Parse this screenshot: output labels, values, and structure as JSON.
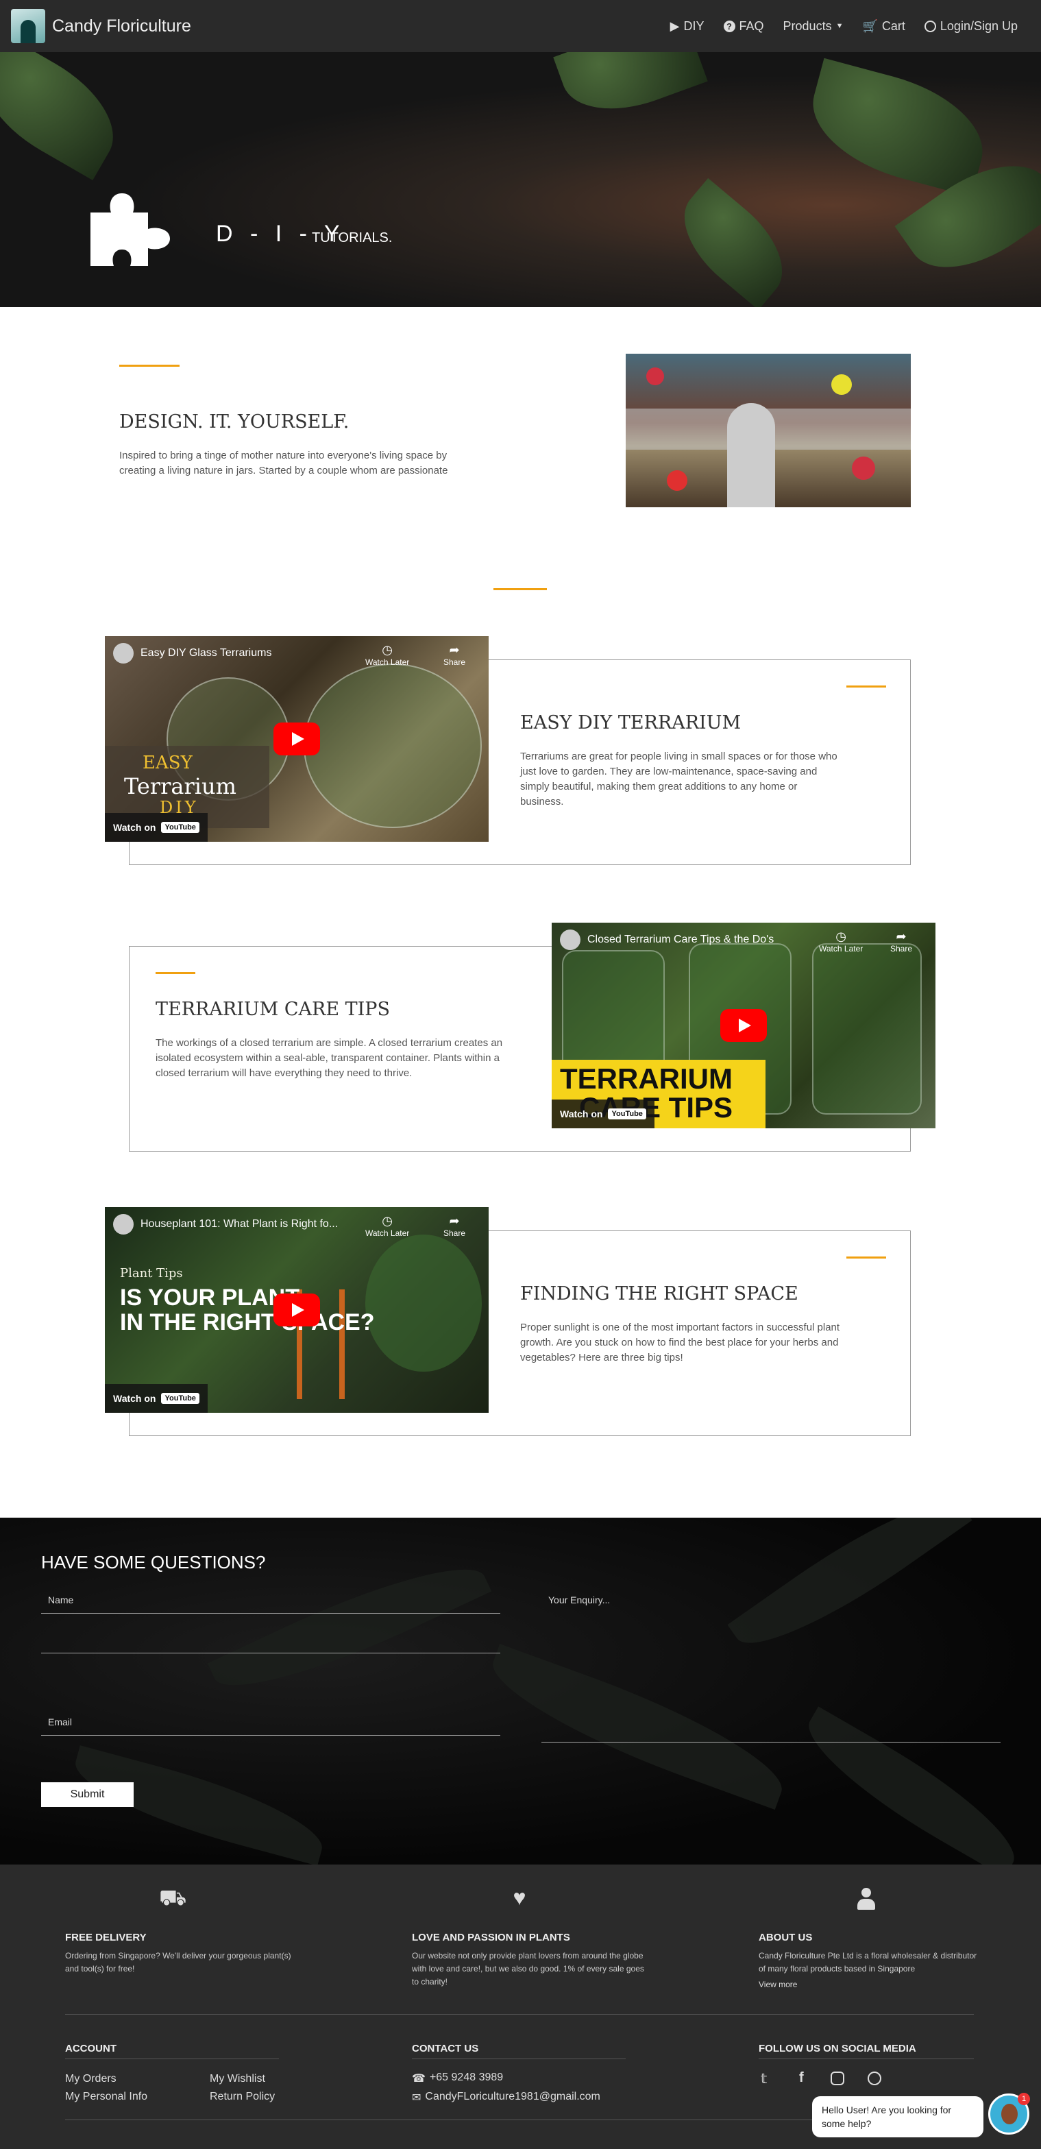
{
  "nav": {
    "brand": "Candy Floriculture",
    "diy": "DIY",
    "faq": "FAQ",
    "products": "Products",
    "cart": "Cart",
    "login": "Login/Sign Up"
  },
  "hero": {
    "title": "D - I - Y",
    "subtitle": "TUTORIALS."
  },
  "intro": {
    "heading": "DESIGN. IT. YOURSELF.",
    "text": "Inspired to bring a tinge of mother nature into everyone's living space by creating a living nature in jars. Started by a couple whom are passionate"
  },
  "tutorials": [
    {
      "video_title": "Easy DIY Glass Terrariums",
      "heading": "EASY DIY TERRARIUM",
      "text": "Terrariums are great for people living in small spaces or for those who just love to garden. They are low-maintenance, space-saving and simply beautiful, making them great additions to any home or business.",
      "overlay_a": "EASY",
      "overlay_b": "Terrarium",
      "overlay_c": "DIY"
    },
    {
      "video_title": "Closed Terrarium Care Tips & the Do's",
      "heading": "TERRARIUM CARE TIPS",
      "text": "The workings of a closed terrarium are simple. A closed terrarium creates an isolated ecosystem within a seal-able, transparent container. Plants within a closed terrarium will have everything they need to thrive.",
      "overlay_a": "TERRARIUM",
      "overlay_b": "CARE TIPS"
    },
    {
      "video_title": "Houseplant 101: What Plant is Right fo...",
      "heading": "FINDING THE RIGHT SPACE",
      "text": "Proper sunlight is one of the most important factors in successful plant growth. Are you stuck on how to find the best place for your herbs and vegetables? Here are three big tips!",
      "overlay_a": "Plant Tips",
      "overlay_b": "IS YOUR PLANT",
      "overlay_c": "IN THE RIGHT SPACE?"
    }
  ],
  "video": {
    "watch_later": "Watch Later",
    "share": "Share",
    "watch_on": "Watch on",
    "youtube": "YouTube"
  },
  "contact": {
    "heading": "HAVE SOME QUESTIONS?",
    "name_placeholder": "Name",
    "email_placeholder": "Email",
    "enquiry_placeholder": "Your Enquiry...",
    "submit": "Submit"
  },
  "footer": {
    "delivery_title": "FREE DELIVERY",
    "delivery_text": "Ordering from Singapore? We'll deliver your gorgeous plant(s) and tool(s) for free!",
    "love_title": "LOVE AND PASSION IN PLANTS",
    "love_text": "Our website not only provide plant lovers from around the globe with love and care!, but we also do good. 1% of every sale goes to charity!",
    "about_title": "ABOUT US",
    "about_text": "Candy Floriculture Pte Ltd is a floral wholesaler & distributor of many floral products based in Singapore",
    "view_more": "View more",
    "account_title": "ACCOUNT",
    "my_orders": "My Orders",
    "my_wishlist": "My Wishlist",
    "my_personal_info": "My Personal Info",
    "return_policy": "Return Policy",
    "contact_title": "CONTACT US",
    "phone": "+65 9248 3989",
    "email": "CandyFLoriculture1981@gmail.com",
    "social_title": "FOLLOW US ON SOCIAL MEDIA"
  },
  "chat": {
    "message": "Hello User! Are you looking for some help?",
    "badge": "1"
  },
  "colors": {
    "accent": "#f0a010",
    "nav_bg": "#2a2a2a",
    "footer_bg": "#2b2b2b"
  }
}
